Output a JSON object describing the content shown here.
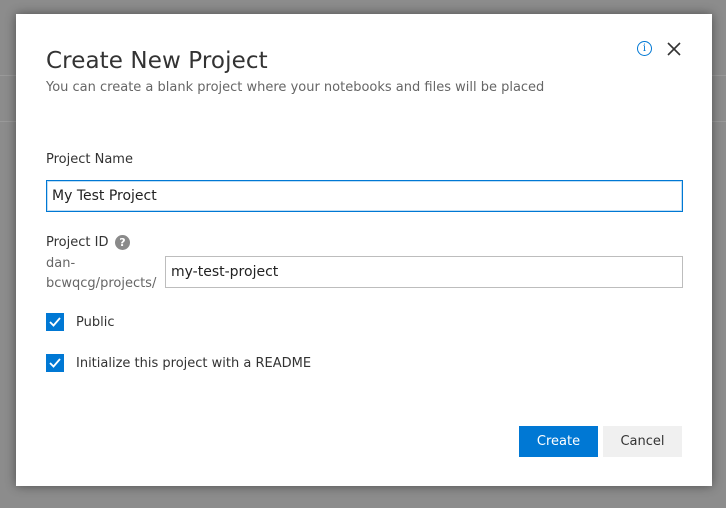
{
  "dialog": {
    "title": "Create New Project",
    "subtitle": "You can create a blank project where your notebooks and files will be placed",
    "info_icon": "info-icon",
    "close_icon": "close-icon"
  },
  "project_name": {
    "label": "Project Name",
    "value": "My Test Project"
  },
  "project_id": {
    "label": "Project ID",
    "help_icon": "question-mark-icon",
    "help_glyph": "?",
    "prefix_line1": "dan-",
    "prefix_line2": "bcwqcg/projects/",
    "value": "my-test-project"
  },
  "options": [
    {
      "label": "Public",
      "checked": true
    },
    {
      "label": "Initialize this project with a README",
      "checked": true
    }
  ],
  "buttons": {
    "create_label": "Create",
    "cancel_label": "Cancel"
  },
  "colors": {
    "accent": "#0078d4",
    "secondary_button": "#f0f0f0",
    "overlay": "#8c8c8c"
  }
}
